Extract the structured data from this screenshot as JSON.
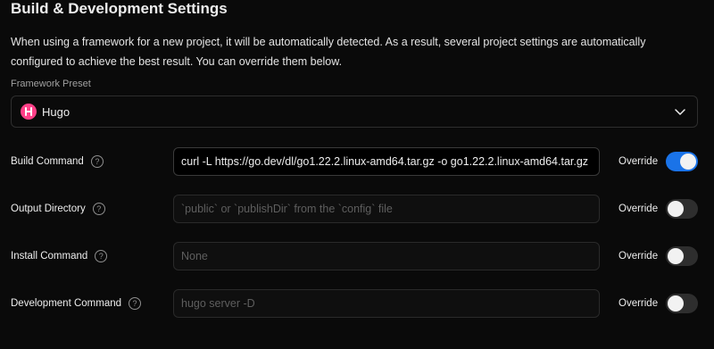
{
  "title": "Build & Development Settings",
  "description": "When using a framework for a new project, it will be automatically detected. As a result, several project settings are automatically configured to achieve the best result. You can override them below.",
  "framework": {
    "label": "Framework Preset",
    "selected": "Hugo",
    "logo_letter": "H",
    "logo_color": "#ff4088"
  },
  "rows": [
    {
      "label": "Build Command",
      "value": "curl -L https://go.dev/dl/go1.22.2.linux-amd64.tar.gz -o go1.22.2.linux-amd64.tar.gz",
      "placeholder": "",
      "override_label": "Override",
      "override_on": true
    },
    {
      "label": "Output Directory",
      "value": "",
      "placeholder": "`public` or `publishDir` from the `config` file",
      "override_label": "Override",
      "override_on": false
    },
    {
      "label": "Install Command",
      "value": "",
      "placeholder": "None",
      "override_label": "Override",
      "override_on": false
    },
    {
      "label": "Development Command",
      "value": "",
      "placeholder": "hugo server -D",
      "override_label": "Override",
      "override_on": false
    }
  ],
  "help_glyph": "?",
  "colors": {
    "toggle_on": "#1a73e8",
    "background": "#0a0a0a"
  }
}
